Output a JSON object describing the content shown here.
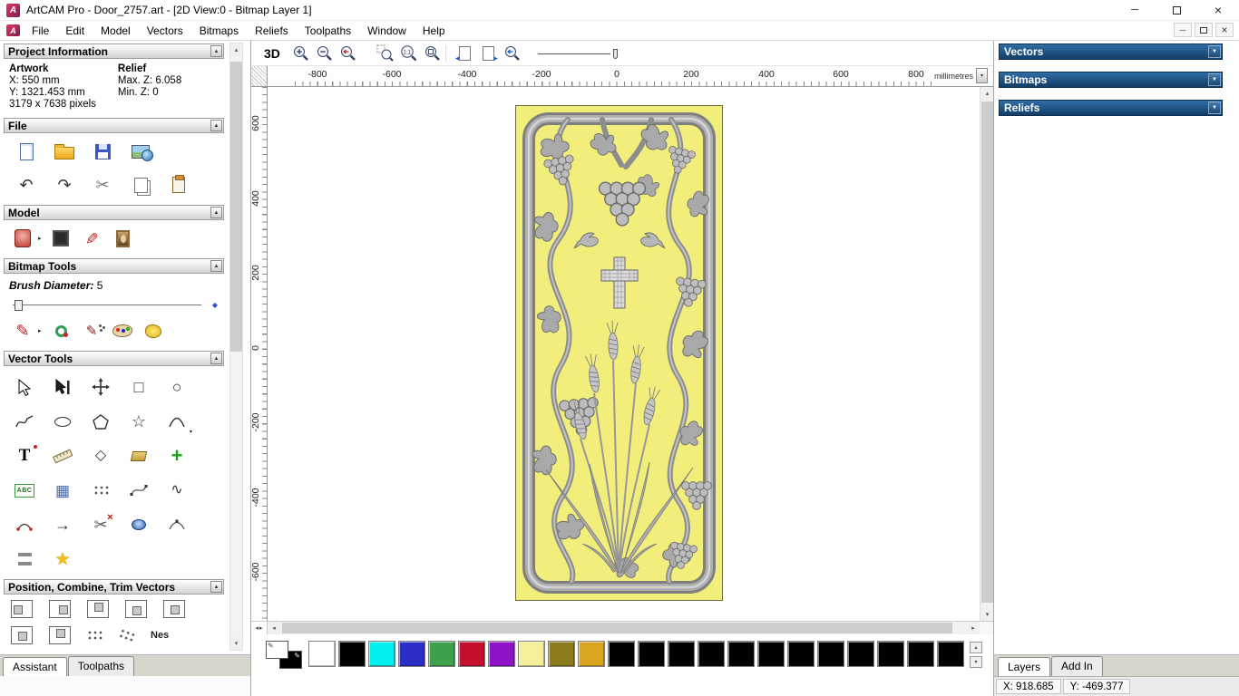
{
  "window": {
    "title": "ArtCAM Pro - Door_2757.art - [2D View:0 - Bitmap Layer 1]"
  },
  "menubar": {
    "items": [
      "File",
      "Edit",
      "Model",
      "Vectors",
      "Bitmaps",
      "Reliefs",
      "Toolpaths",
      "Window",
      "Help"
    ]
  },
  "assistant": {
    "tabs": [
      "Assistant",
      "Toolpaths"
    ],
    "project_information": {
      "title": "Project Information",
      "artwork_label": "Artwork",
      "artwork_x": "X: 550 mm",
      "artwork_y": "Y: 1321.453 mm",
      "artwork_pixels": "3179 x 7638 pixels",
      "relief_label": "Relief",
      "relief_max_z": "Max. Z: 6.058",
      "relief_min_z": "Min. Z: 0"
    },
    "file_section": {
      "title": "File"
    },
    "model_section": {
      "title": "Model"
    },
    "bitmap_tools": {
      "title": "Bitmap Tools",
      "brush_diameter_label": "Brush Diameter:",
      "brush_diameter_value": "5"
    },
    "vector_tools": {
      "title": "Vector Tools"
    },
    "position_section": {
      "title": "Position, Combine, Trim Vectors",
      "nest_label": "Nes"
    }
  },
  "view_toolbar": {
    "mode_3d_label": "3D"
  },
  "ruler": {
    "horizontal": [
      "-800",
      "-600",
      "-400",
      "-200",
      "0",
      "200",
      "400",
      "600",
      "800"
    ],
    "vertical": [
      "600",
      "400",
      "200",
      "0",
      "-200",
      "-400",
      "-600"
    ],
    "units": "millimetres"
  },
  "artwork": {
    "background_color": "#f2ee7c"
  },
  "right_panel": {
    "sections": [
      "Vectors",
      "Bitmaps",
      "Reliefs"
    ],
    "tabs": [
      "Layers",
      "Add In"
    ]
  },
  "statusbar": {
    "x": "X: 918.685",
    "y": "Y: -469.377"
  },
  "palette": {
    "primary": "#ffffff",
    "secondary": "#000000",
    "colors": [
      "#ffffff",
      "#000000",
      "#00f0f0",
      "#2d2dc8",
      "#3fa04c",
      "#c60f2d",
      "#8e13c8",
      "#f4f09a",
      "#8c7c1e",
      "#d9a51e",
      "#000000",
      "#000000",
      "#000000",
      "#000000",
      "#000000",
      "#000000",
      "#000000",
      "#000000",
      "#000000",
      "#000000",
      "#000000",
      "#000000"
    ]
  },
  "icons": {
    "minimize": "─",
    "close": "×",
    "undo": "↶",
    "redo": "↷",
    "cut": "✂",
    "pencil": "✎",
    "rectangle": "□",
    "circle": "○",
    "star": "☆",
    "star_filled": "★",
    "diamond": "◇",
    "grid": "▦",
    "wave": "∿",
    "text_tool": "T",
    "plus": "+",
    "arrow_right": "→",
    "abc": "ABC",
    "one_to_one": "1:1",
    "dropdown": "▼",
    "up": "▲",
    "small_up": "▴",
    "small_down": "▾",
    "small_left": "◂",
    "small_right": "▸",
    "blue_diamond": "◆"
  }
}
